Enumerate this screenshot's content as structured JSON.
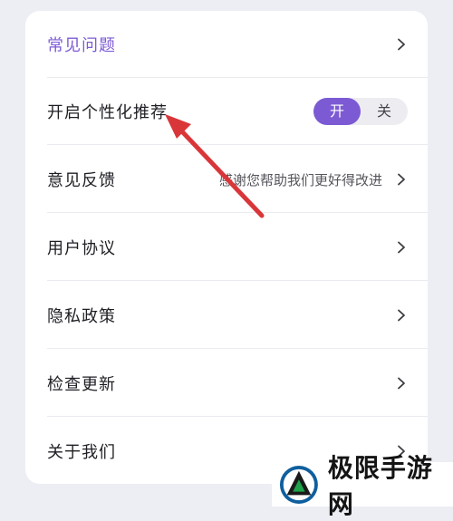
{
  "settings": {
    "items": [
      {
        "label": "常见问题"
      },
      {
        "label": "开启个性化推荐"
      },
      {
        "label": "意见反馈",
        "description": "感谢您帮助我们更好得改进"
      },
      {
        "label": "用户协议"
      },
      {
        "label": "隐私政策"
      },
      {
        "label": "检查更新"
      },
      {
        "label": "关于我们"
      }
    ],
    "toggle": {
      "on_label": "开",
      "off_label": "关",
      "selected": "开"
    }
  },
  "watermark": {
    "text": "极限手游网"
  },
  "colors": {
    "accent": "#7c5ad4",
    "arrow": "#d9363a",
    "background": "#eceef4"
  }
}
